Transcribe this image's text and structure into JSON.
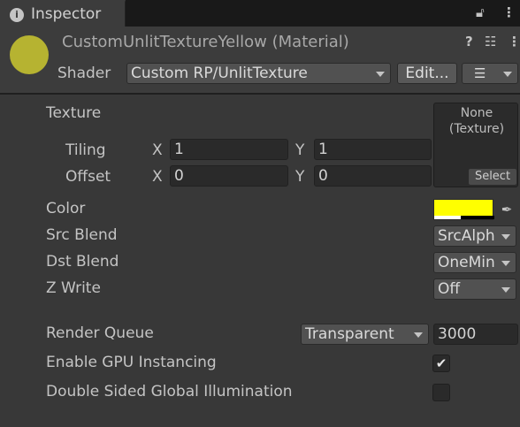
{
  "window": {
    "tab_label": "Inspector",
    "info_icon": "info-icon",
    "lock_icon": "lock-icon",
    "menu_icon": "kebab-menu-icon"
  },
  "material": {
    "swatch_color": "#b6b331",
    "name": "CustomUnlitTextureYellow (Material)",
    "help_icon": "help-icon",
    "preset_icon": "preset-sliders-icon",
    "menu_icon": "kebab-menu-icon"
  },
  "shader": {
    "label": "Shader",
    "value": "Custom RP/UnlitTexture",
    "edit_label": "Edit...",
    "list_icon": "list-icon"
  },
  "properties": {
    "texture": {
      "label": "Texture",
      "slot_line1": "None",
      "slot_line2": "(Texture)",
      "select_label": "Select"
    },
    "tiling": {
      "label": "Tiling",
      "x_label": "X",
      "x": "1",
      "y_label": "Y",
      "y": "1"
    },
    "offset": {
      "label": "Offset",
      "x_label": "X",
      "x": "0",
      "y_label": "Y",
      "y": "0"
    },
    "color": {
      "label": "Color",
      "value": "#ffff00",
      "picker_icon": "eyedropper-icon"
    },
    "src_blend": {
      "label": "Src Blend",
      "value": "SrcAlph"
    },
    "dst_blend": {
      "label": "Dst Blend",
      "value": "OneMin"
    },
    "z_write": {
      "label": "Z Write",
      "value": "Off"
    }
  },
  "advanced": {
    "render_queue": {
      "label": "Render Queue",
      "preset": "Transparent",
      "value": "3000"
    },
    "gpu_instancing": {
      "label": "Enable GPU Instancing",
      "checked": true
    },
    "double_sided_gi": {
      "label": "Double Sided Global Illumination",
      "checked": false
    }
  }
}
